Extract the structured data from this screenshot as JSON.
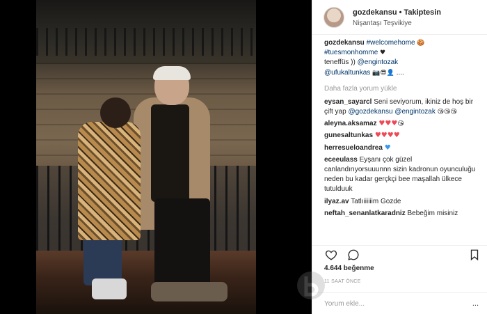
{
  "post": {
    "username": "gozdekansu",
    "follow_label": "Takiptesin",
    "separator": "•",
    "location": "Nişantaşı Teşvikiye"
  },
  "caption": {
    "username": "gozdekansu",
    "tags": "#welcomehome",
    "tags2": "#tuesmonhomme",
    "text": "teneffüs )) ",
    "mention1": "@engintozak",
    "mention2": "@ufukaltunkas",
    "trail": "...."
  },
  "load_more": "Daha fazla yorum yükle",
  "comments": [
    {
      "user": "eysan_sayarcl",
      "text": "Seni seviyorum, ikiniz de hoş bir çift yap ",
      "mention1": "@gozdekansu",
      "mention2": "@engintozak"
    },
    {
      "user": "aleyna.aksamaz",
      "text": ""
    },
    {
      "user": "gunesaltunkas",
      "text": ""
    },
    {
      "user": "herresueloandrea",
      "text": ""
    },
    {
      "user": "eceeulass",
      "text": "Eyşanı çok güzel canlandırıyorsuuunnn sizin kadronun oyunculuğu neden bu kadar gerçkçi bee maşallah ülkece tutulduuk"
    },
    {
      "user": "ilyaz.av",
      "text": "Tatlıiiiiiim Gozde"
    },
    {
      "user": "neftah_senanlatkaradniz",
      "text": "Bebeğim misiniz"
    }
  ],
  "icons": {
    "like": "heart-icon",
    "comment": "comment-icon",
    "save": "bookmark-icon"
  },
  "likes": "4.644 beğenme",
  "time": "11 SAAT ÖNCE",
  "add_comment_placeholder": "Yorum ekle...",
  "more_label": "..."
}
